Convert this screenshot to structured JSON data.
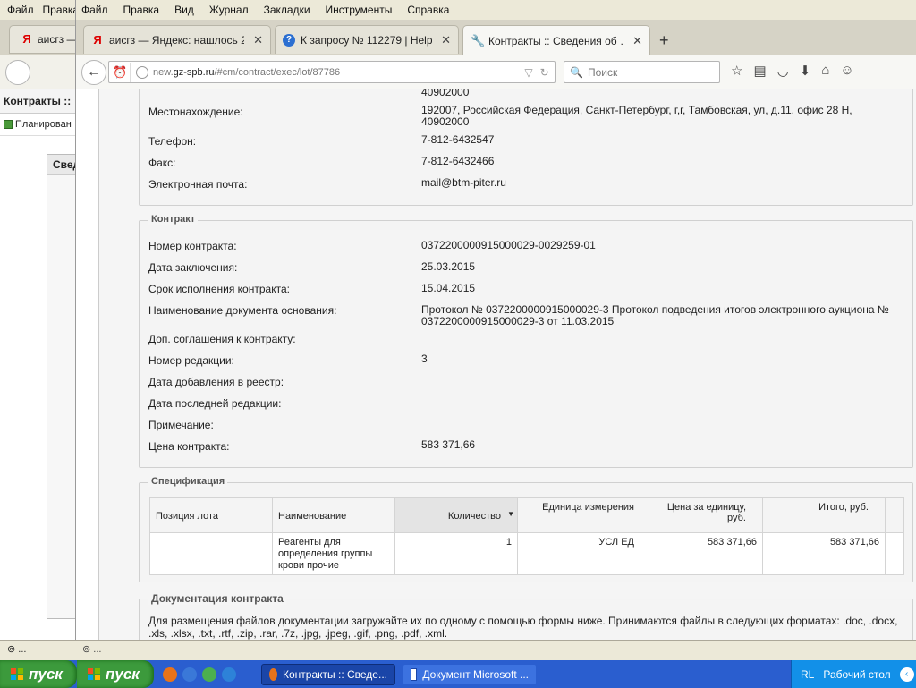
{
  "bg_window": {
    "menu": [
      "Файл",
      "Правка"
    ],
    "tab_title": "аисгз —",
    "page_title": "Контракты ::",
    "plan_item": "Планирован",
    "panel_title": "Свед",
    "status": "⊚ ..."
  },
  "menu": [
    "Файл",
    "Правка",
    "Вид",
    "Журнал",
    "Закладки",
    "Инструменты",
    "Справка"
  ],
  "tabs": [
    {
      "title": "аисгз — Яндекс: нашлось 2…",
      "icon": "yandex-icon",
      "active": false
    },
    {
      "title": "К запросу № 112279 | HelpD…",
      "icon": "help-icon",
      "active": false
    },
    {
      "title": "Контракты :: Сведения об …",
      "icon": "wrench-icon",
      "active": true
    }
  ],
  "nav": {
    "url_prefix": "new.",
    "url_domain": "gz-spb.ru",
    "url_path": "/#cm/contract/exec/lot/87786",
    "search_placeholder": "Поиск"
  },
  "supplier": {
    "top_cut": "40902000",
    "fields": [
      {
        "label": "Местонахождение:",
        "value": "192007, Российская Федерация, Санкт-Петербург, г,г, Тамбовская, ул, д.11, офис 28 Н, 40902000"
      },
      {
        "label": "Телефон:",
        "value": "7-812-6432547"
      },
      {
        "label": "Факс:",
        "value": "7-812-6432466"
      },
      {
        "label": "Электронная почта:",
        "value": "mail@btm-piter.ru"
      }
    ]
  },
  "contract": {
    "legend": "Контракт",
    "fields": [
      {
        "label": "Номер контракта:",
        "value": "0372200000915000029-0029259-01"
      },
      {
        "label": "Дата заключения:",
        "value": "25.03.2015"
      },
      {
        "label": "Срок исполнения контракта:",
        "value": "15.04.2015"
      },
      {
        "label": "Наименование документа основания:",
        "value": "Протокол № 0372200000915000029-3 Протокол подведения итогов электронного аукциона № 0372200000915000029-3 от 11.03.2015"
      },
      {
        "label": "Доп. соглашения к контракту:",
        "value": ""
      },
      {
        "label": "Номер редакции:",
        "value": "3"
      },
      {
        "label": "Дата добавления в реестр:",
        "value": ""
      },
      {
        "label": "Дата последней редакции:",
        "value": ""
      },
      {
        "label": "Примечание:",
        "value": ""
      },
      {
        "label": "Цена контракта:",
        "value": "583 371,66"
      }
    ]
  },
  "spec": {
    "legend": "Спецификация",
    "columns": [
      "Позиция лота",
      "Наименование",
      "Количество",
      "Единица измерения",
      "Цена за единицу, руб.",
      "Итого, руб."
    ],
    "rows": [
      {
        "pos": "",
        "name": "Реагенты для определения группы крови прочие",
        "qty": "1",
        "unit": "УСЛ ЕД",
        "price": "583 371,66",
        "total": "583 371,66"
      }
    ]
  },
  "docs": {
    "legend": "Документация контракта",
    "text": "Для размещения файлов документации загружайте их по одному с помощью формы ниже. Принимаются файлы в следующих форматах: .doc, .docx, .xls, .xlsx, .txt, .rtf, .zip, .rar, .7z, .jpg, .jpeg, .gif, .png, .pdf, .xml."
  },
  "status": "⊚ ...",
  "taskbar": {
    "start": [
      "пуск",
      "пуск"
    ],
    "buttons": [
      "Контракты :: Сведе...",
      "Документ Microsoft ..."
    ],
    "lang": "RL",
    "desktop": "Рабочий стол"
  }
}
